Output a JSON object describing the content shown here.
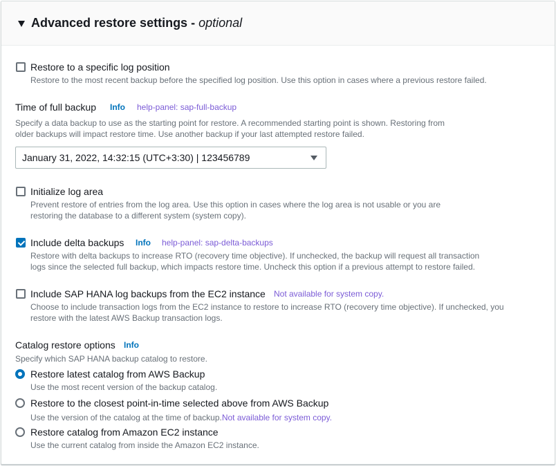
{
  "header": {
    "title": "Advanced restore settings -",
    "title_optional": "optional"
  },
  "log_position": {
    "label": "Restore to a specific log position",
    "description": "Restore to the most recent backup before the specified log position. Use this option in cases where a previous restore failed.",
    "checked": false
  },
  "full_backup": {
    "label": "Time of full backup",
    "info": "Info",
    "help": "help-panel: sap-full-backup",
    "description_1": "Specify a data backup to use as the starting point for restore. A recommended starting point is shown. Restoring from",
    "description_2": "older backups will impact restore time. Use another backup if your last attempted restore failed.",
    "selected": "January 31, 2022, 14:32:15 (UTC+3:30) | 123456789"
  },
  "init_log_area": {
    "label": "Initialize log area",
    "description_1": "Prevent restore of entries from the log area. Use this option in cases where the log area is not usable or you are",
    "description_2": "restoring the database to a different system (system copy).",
    "checked": false
  },
  "delta_backups": {
    "label": "Include delta backups",
    "info": "Info",
    "help": "help-panel: sap-delta-backups",
    "description_1": "Restore with delta backups to increase RTO (recovery time objective). If unchecked, the backup will request all transaction",
    "description_2": "logs since the selected full backup, which impacts restore time. Uncheck this option if a previous attempt to restore failed.",
    "checked": true
  },
  "hana_log_backups": {
    "label": "Include SAP HANA log backups from the EC2 instance",
    "note": "Not available for system copy.",
    "description_1": "Choose to include transaction logs from the EC2 instance to restore to increase RTO (recovery time objective). If unchecked, you",
    "description_2": "restore with the latest AWS Backup transaction logs.",
    "checked": false
  },
  "catalog": {
    "label": "Catalog restore options",
    "info": "Info",
    "description": "Specify which SAP HANA backup catalog to restore.",
    "options": [
      {
        "label": "Restore latest catalog from AWS Backup",
        "description": "Use the most recent version of the backup catalog.",
        "selected": true
      },
      {
        "label": "Restore to the closest point-in-time selected above from AWS Backup",
        "description": "Use the version of the catalog at the time of backup.",
        "note": "Not available for system copy.",
        "selected": false
      },
      {
        "label": "Restore catalog from Amazon EC2 instance",
        "description": "Use the current catalog from inside the Amazon EC2 instance.",
        "selected": false
      }
    ]
  }
}
